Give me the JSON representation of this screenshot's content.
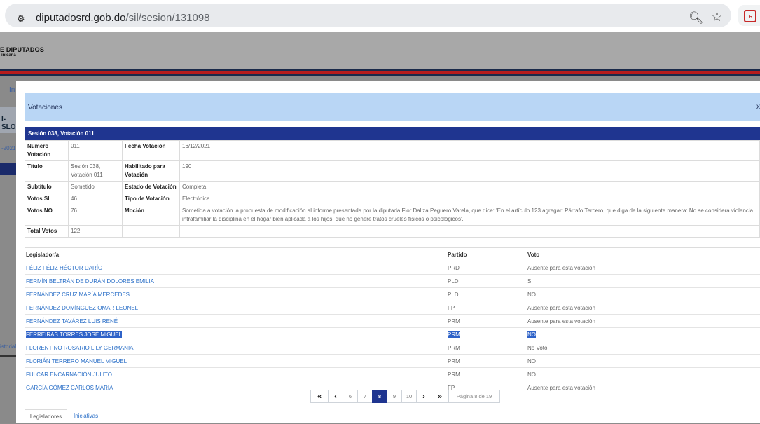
{
  "browser": {
    "url_host": "diputadosrd.gob.do",
    "url_path": "/sil/sesion/131098"
  },
  "background": {
    "brand_line1": "E DIPUTADOS",
    "brand_line2": "inicana",
    "nav_fragment": "In",
    "side_fragment": "I-SLO",
    "date_fragment": "-2021 -",
    "history_fragment": "istorial"
  },
  "modal": {
    "header_title": "Votaciones",
    "close_label": "x",
    "session_title": "Sesión 038, Votación 011",
    "details": {
      "numero_label": "Número Votación",
      "numero_value": "011",
      "fecha_label": "Fecha Votación",
      "fecha_value": "16/12/2021",
      "titulo_label": "Título",
      "titulo_value": "Sesión 038, Votación 011",
      "habilitado_label": "Habilitado para Votación",
      "habilitado_value": "190",
      "subtitulo_label": "Subtítulo",
      "subtitulo_value": "Sometido",
      "estado_label": "Estado de Votación",
      "estado_value": "Completa",
      "si_label": "Votos SI",
      "si_value": "46",
      "tipo_label": "Tipo de Votación",
      "tipo_value": "Electrónica",
      "no_label": "Votos NO",
      "no_value": "76",
      "mocion_label": "Moción",
      "mocion_value": "Sometida a votación la propuesta de modificación al informe presentada por la diputada Fior Daliza Peguero Varela, que dice: 'En el artículo 123 agregar: Párrafo Tercero, que diga de la siguiente manera: No se considera violencia intrafamiliar la disciplina en el hogar bien aplicada a los hijos, que no genere tratos crueles físicos o psicológicos'.",
      "total_label": "Total Votos",
      "total_value": "122"
    },
    "legislators": {
      "headers": [
        "Legislador/a",
        "Partido",
        "Voto"
      ],
      "rows": [
        {
          "name": "FÉLIZ FÉLIZ HÉCTOR DARÍO",
          "party": "PRD",
          "vote": "Ausente para esta votación"
        },
        {
          "name": "FERMÍN BELTRÁN DE DURÁN DOLORES EMILIA",
          "party": "PLD",
          "vote": "SI"
        },
        {
          "name": "FERNÁNDEZ CRUZ MARÍA MERCEDES",
          "party": "PLD",
          "vote": "NO"
        },
        {
          "name": "FERNÁNDEZ DOMÍNGUEZ OMAR LEONEL",
          "party": "FP",
          "vote": "Ausente para esta votación"
        },
        {
          "name": "FERNÁNDEZ TAVÁREZ LUIS RENÉ",
          "party": "PRM",
          "vote": "Ausente para esta votación"
        },
        {
          "name": "FERREIRAS TORRES JOSÉ MIGUEL",
          "party": "PRM",
          "vote": "NO"
        },
        {
          "name": "FLORENTINO ROSARIO LILY GERMANIA",
          "party": "PRM",
          "vote": "No Voto"
        },
        {
          "name": "FLORIÁN TERRERO MANUEL MIGUEL",
          "party": "PRM",
          "vote": "NO"
        },
        {
          "name": "FULCAR ENCARNACIÓN JULITO",
          "party": "PRM",
          "vote": "NO"
        },
        {
          "name": "GARCÍA GÓMEZ CARLOS MARÍA",
          "party": "FP",
          "vote": "Ausente para esta votación"
        }
      ]
    },
    "pagination": {
      "first": "«",
      "prev": "‹",
      "pages": [
        "6",
        "7",
        "8",
        "9",
        "10"
      ],
      "next": "›",
      "last": "»",
      "info": "Página 8 de 19"
    },
    "tabs": {
      "active": "Legisladores",
      "other": "Iniciativas"
    }
  }
}
